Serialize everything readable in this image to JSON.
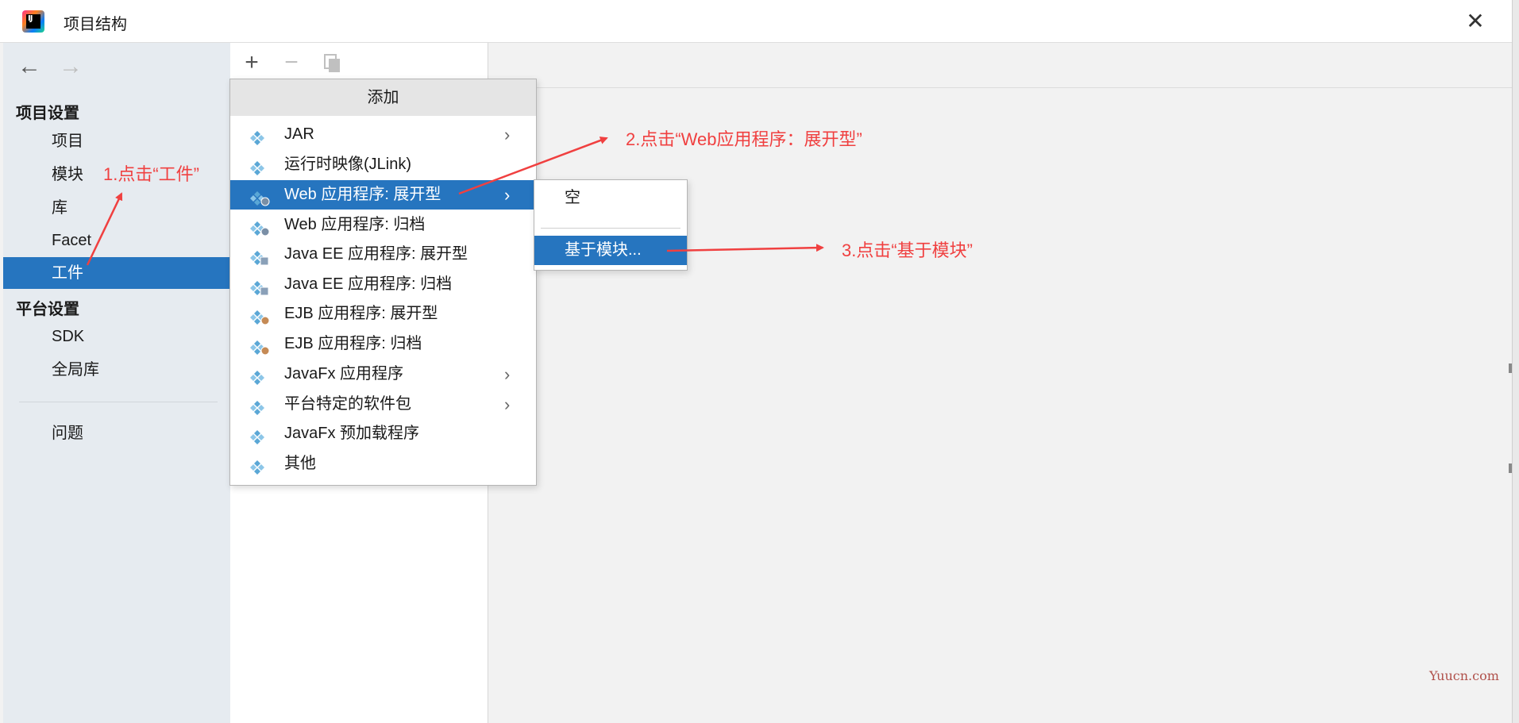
{
  "window": {
    "title": "项目结构",
    "close_glyph": "✕"
  },
  "sidebar": {
    "nav_back": "←",
    "nav_forward": "→",
    "project_settings_header": "项目设置",
    "platform_settings_header": "平台设置",
    "items": [
      {
        "label": "项目"
      },
      {
        "label": "模块"
      },
      {
        "label": "库"
      },
      {
        "label": "Facet"
      },
      {
        "label": "工件",
        "selected": true
      },
      {
        "label": "SDK"
      },
      {
        "label": "全局库"
      },
      {
        "label": "问题"
      }
    ]
  },
  "toolbar": {
    "add": "+",
    "remove": "−",
    "copy_icon": "copy-icon"
  },
  "add_popup": {
    "title": "添加",
    "items": [
      {
        "label": "JAR",
        "icon": "artifact-icon",
        "submenu": true
      },
      {
        "label": "运行时映像(JLink)",
        "icon": "artifact-icon",
        "submenu": false
      },
      {
        "label": "Web 应用程序: 展开型",
        "icon": "web-artifact-icon",
        "submenu": true,
        "highlighted": true
      },
      {
        "label": "Web 应用程序: 归档",
        "icon": "web-artifact-icon",
        "submenu": false
      },
      {
        "label": "Java EE 应用程序: 展开型",
        "icon": "javaee-artifact-icon",
        "submenu": false
      },
      {
        "label": "Java EE 应用程序: 归档",
        "icon": "javaee-artifact-icon",
        "submenu": false
      },
      {
        "label": "EJB 应用程序: 展开型",
        "icon": "ejb-artifact-icon",
        "submenu": false
      },
      {
        "label": "EJB 应用程序: 归档",
        "icon": "ejb-artifact-icon",
        "submenu": false
      },
      {
        "label": "JavaFx 应用程序",
        "icon": "artifact-icon",
        "submenu": true
      },
      {
        "label": "平台特定的软件包",
        "icon": "artifact-icon",
        "submenu": true
      },
      {
        "label": "JavaFx 预加载程序",
        "icon": "artifact-icon",
        "submenu": false
      },
      {
        "label": "其他",
        "icon": "artifact-icon",
        "submenu": false
      }
    ]
  },
  "sub_popup": {
    "items": [
      {
        "label": "空"
      },
      {
        "label": "基于模块...",
        "highlighted": true
      }
    ]
  },
  "annotations": {
    "step1": "1.点击“工件”",
    "step2": "2.点击“Web应用程序：展开型”",
    "step3": "3.点击“基于模块”",
    "color": "#f04040"
  },
  "colors": {
    "selection": "#2675bf",
    "sidebar_bg": "#e6ebf0"
  },
  "watermark": "Yuucn.com"
}
